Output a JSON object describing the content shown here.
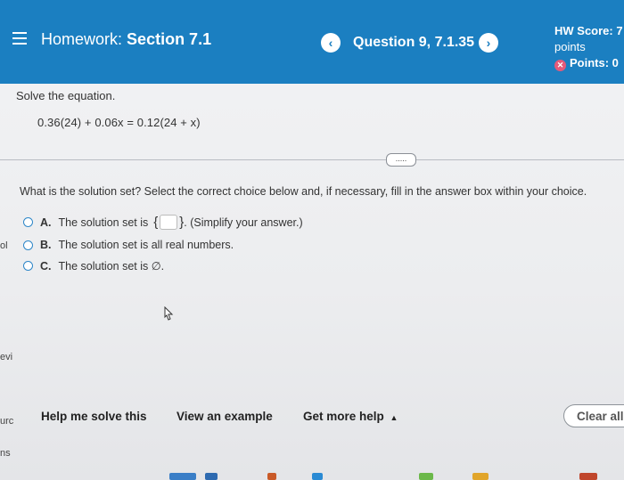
{
  "header": {
    "menu_icon": "hamburger-menu-icon",
    "title_prefix": "Homework:",
    "title_section": "Section 7.1",
    "question_label": "Question 9, 7.1.35",
    "prev_icon": "chevron-left-icon",
    "next_icon": "chevron-right-icon",
    "score_label": "HW Score: 7",
    "score_unit": "points",
    "points_label": "Points: 0",
    "accent_color": "#1b7fc1"
  },
  "problem": {
    "prompt": "Solve the equation.",
    "equation": "0.36(24) + 0.06x = 0.12(24 + x)",
    "expand_label": "....."
  },
  "question": {
    "text": "What is the solution set? Select the correct choice below and, if necessary, fill in the answer box within your choice.",
    "choices": [
      {
        "letter": "A.",
        "prefix": "The solution set is",
        "suffix": ". (Simplify your answer.)"
      },
      {
        "letter": "B.",
        "text": "The solution set is all real numbers."
      },
      {
        "letter": "C.",
        "text": "The solution set is ∅."
      }
    ]
  },
  "footer": {
    "help": "Help me solve this",
    "example": "View an example",
    "more_help": "Get more help",
    "more_help_icon": "caret-up-icon",
    "clear": "Clear all"
  },
  "left_edge_fragments": [
    "ol",
    "evi",
    "urc",
    "ns"
  ]
}
